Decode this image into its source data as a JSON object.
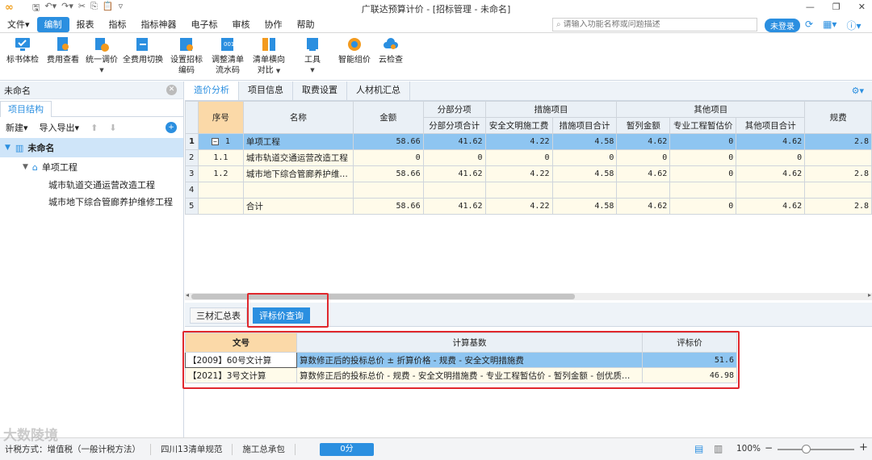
{
  "window": {
    "title": "广联达预算计价 - [招标管理 - 未命名]"
  },
  "menu": {
    "items": [
      "文件",
      "编制",
      "报表",
      "指标",
      "指标神器",
      "电子标",
      "审核",
      "协作",
      "帮助"
    ],
    "active": "编制",
    "search_placeholder": "请输入功能名称或问题描述",
    "login": "未登录"
  },
  "ribbon": {
    "buttons": [
      {
        "label": "标书体检"
      },
      {
        "label": "费用查看"
      },
      {
        "label": "统一调价"
      },
      {
        "label": "全费用切换"
      },
      {
        "label": "设置招标",
        "label2": "编码"
      },
      {
        "label": "调整清单",
        "label2": "流水码"
      },
      {
        "label": "清单横向",
        "label2": "对比"
      },
      {
        "label": "工具"
      },
      {
        "label": "智能组价"
      },
      {
        "label": "云检查"
      }
    ]
  },
  "left_panel": {
    "header": "未命名",
    "tab": "项目结构",
    "new": "新建",
    "import_export": "导入导出",
    "tree": {
      "root": "未命名",
      "child": "单项工程",
      "leaves": [
        "城市轨道交通运营改造工程",
        "城市地下综合管廊养护维修工程"
      ]
    }
  },
  "main_tabs": [
    "造价分析",
    "项目信息",
    "取费设置",
    "人材机汇总"
  ],
  "grid": {
    "headers": {
      "seq": "序号",
      "name": "名称",
      "amount": "金额",
      "group_fbfx": "分部分项",
      "fbfx_total": "分部分项合计",
      "group_measures": "措施项目",
      "safety": "安全文明施工费",
      "measures_total": "措施项目合计",
      "group_other": "其他项目",
      "provisional": "暂列金额",
      "prof_est": "专业工程暂估价",
      "other_total": "其他项目合计",
      "fees": "规费"
    },
    "rows": [
      {
        "rn": "1",
        "seq": "1",
        "name": "单项工程",
        "amount": "58.66",
        "fbfx": "41.62",
        "safety": "4.22",
        "measures": "4.58",
        "provisional": "4.62",
        "prof_est": "0",
        "other": "4.62",
        "fees": "2.8"
      },
      {
        "rn": "2",
        "seq": "1.1",
        "name": "城市轨道交通运营改造工程",
        "amount": "0",
        "fbfx": "0",
        "safety": "0",
        "measures": "0",
        "provisional": "0",
        "prof_est": "0",
        "other": "0",
        "fees": ""
      },
      {
        "rn": "3",
        "seq": "1.2",
        "name": "城市地下综合管廊养护维…",
        "amount": "58.66",
        "fbfx": "41.62",
        "safety": "4.22",
        "measures": "4.58",
        "provisional": "4.62",
        "prof_est": "0",
        "other": "4.62",
        "fees": "2.8"
      },
      {
        "rn": "4",
        "seq": "",
        "name": "",
        "amount": "",
        "fbfx": "",
        "safety": "",
        "measures": "",
        "provisional": "",
        "prof_est": "",
        "other": "",
        "fees": ""
      },
      {
        "rn": "5",
        "seq": "",
        "name": "合计",
        "amount": "58.66",
        "fbfx": "41.62",
        "safety": "4.22",
        "measures": "4.58",
        "provisional": "4.62",
        "prof_est": "0",
        "other": "4.62",
        "fees": "2.8"
      }
    ]
  },
  "bottom_tabs": [
    "三材汇总表",
    "评标价查询"
  ],
  "eval_grid": {
    "headers": {
      "doc": "文号",
      "basis": "计算基数",
      "price": "评标价"
    },
    "rows": [
      {
        "doc": "【2009】60号文计算",
        "basis": "算数修正后的投标总价 ± 折算价格 - 规费 - 安全文明措施费",
        "price": "51.6"
      },
      {
        "doc": "【2021】3号文计算",
        "basis": "算数修正后的投标总价 - 规费 - 安全文明措施费 - 专业工程暂估价 - 暂列金额 - 创优质…",
        "price": "46.98"
      }
    ]
  },
  "status": {
    "calc_mode": "计税方式：增值税（一般计税方法）",
    "rules": "四川13清单规范",
    "contract": "施工总承包",
    "progress": "0分",
    "zoom": "100%"
  },
  "watermark": "大数陵境",
  "colors": {
    "accent": "#2b8fe0",
    "highlight": "#e0282d",
    "row_selected": "#8ec5f1"
  }
}
